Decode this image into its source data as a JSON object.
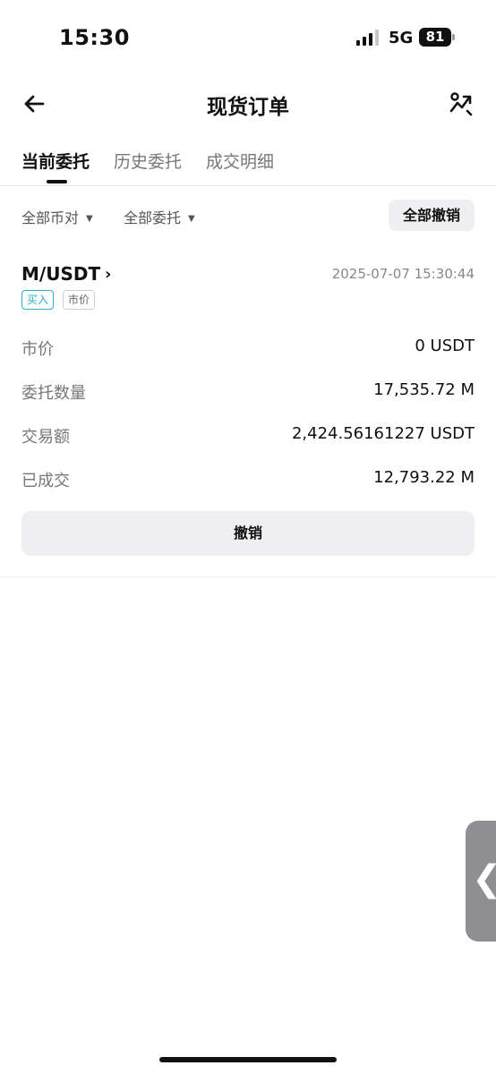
{
  "status_bar": {
    "time": "15:30",
    "network": "5G",
    "battery": "81"
  },
  "header": {
    "title": "现货订单",
    "back_icon": "arrow-left-icon",
    "share_icon": "share-chart-icon"
  },
  "tabs": [
    {
      "label": "当前委托",
      "active": true
    },
    {
      "label": "历史委托",
      "active": false
    },
    {
      "label": "成交明细",
      "active": false
    }
  ],
  "filters": {
    "pair_filter": "全部币对",
    "type_filter": "全部委托",
    "cancel_all": "全部撤销"
  },
  "order": {
    "pair": "M/USDT",
    "time": "2025-07-07 15:30:44",
    "side": "买入",
    "order_type": "市价",
    "rows": [
      {
        "label": "市价",
        "value": "0 USDT"
      },
      {
        "label": "委托数量",
        "value": "17,535.72 M"
      },
      {
        "label": "交易额",
        "value": "2,424.56161227 USDT"
      },
      {
        "label": "已成交",
        "value": "12,793.22 M"
      }
    ],
    "cancel_label": "撤销"
  },
  "colors": {
    "buy": "#2ab0c9",
    "button_bg": "#efeff1",
    "muted_text": "#777777"
  }
}
